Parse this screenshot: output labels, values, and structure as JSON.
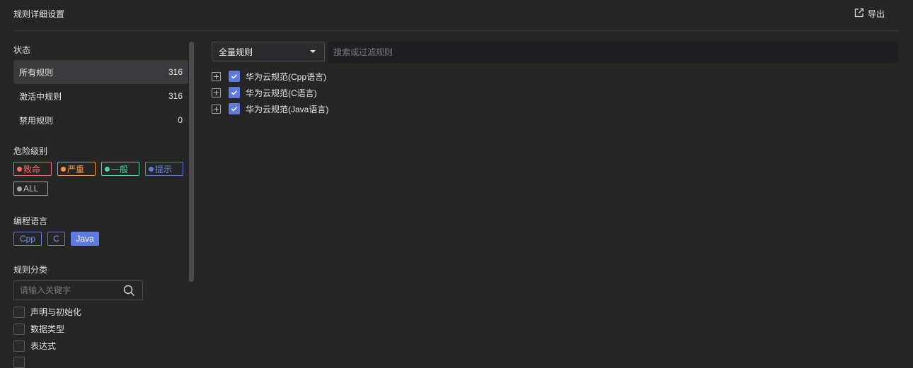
{
  "header": {
    "title": "规则详细设置",
    "export_label": "导出"
  },
  "status": {
    "title": "状态",
    "items": [
      {
        "label": "所有规则",
        "count": "316"
      },
      {
        "label": "激活中规则",
        "count": "316"
      },
      {
        "label": "禁用规则",
        "count": "0"
      }
    ]
  },
  "severity": {
    "title": "危险级别",
    "items": [
      {
        "label": "致命",
        "color": "#f66f6a"
      },
      {
        "label": "严重",
        "color": "#fa9841"
      },
      {
        "label": "一般",
        "color": "#50d4ab"
      },
      {
        "label": "提示",
        "color": "#5e7ce0"
      },
      {
        "label": "ALL",
        "color": "#a8a8a8"
      }
    ]
  },
  "language": {
    "title": "编程语言",
    "items": [
      {
        "label": "Cpp"
      },
      {
        "label": "C"
      },
      {
        "label": "Java"
      }
    ]
  },
  "category": {
    "title": "规则分类",
    "search_placeholder": "请输入关键字",
    "items": [
      {
        "label": "声明与初始化"
      },
      {
        "label": "数据类型"
      },
      {
        "label": "表达式"
      }
    ]
  },
  "main": {
    "dropdown_value": "全量规则",
    "filter_placeholder": "搜索或过滤规则",
    "rules": [
      {
        "label": "华为云规范(Cpp语言)"
      },
      {
        "label": "华为云规范(C语言)"
      },
      {
        "label": "华为云规范(Java语言)"
      }
    ]
  }
}
